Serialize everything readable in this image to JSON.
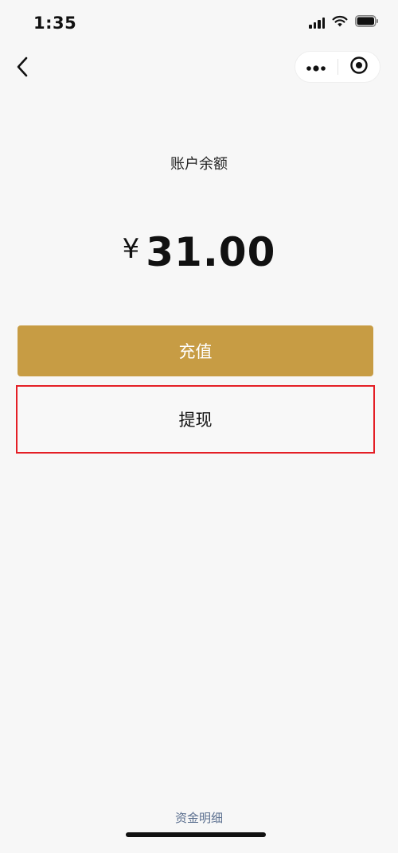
{
  "status_bar": {
    "time": "1:35"
  },
  "nav": {
    "back_icon": "chevron-left-icon",
    "more_icon": "more-dots-icon",
    "close_icon": "target-circle-icon"
  },
  "account": {
    "balance_label": "账户余额",
    "currency_symbol": "¥",
    "balance_value": "31.00"
  },
  "actions": {
    "recharge_label": "充值",
    "withdraw_label": "提现"
  },
  "footer": {
    "fund_detail_label": "资金明细"
  },
  "colors": {
    "accent": "#c79c44",
    "highlight_border": "#e41f26",
    "link": "#5b6f8f"
  }
}
